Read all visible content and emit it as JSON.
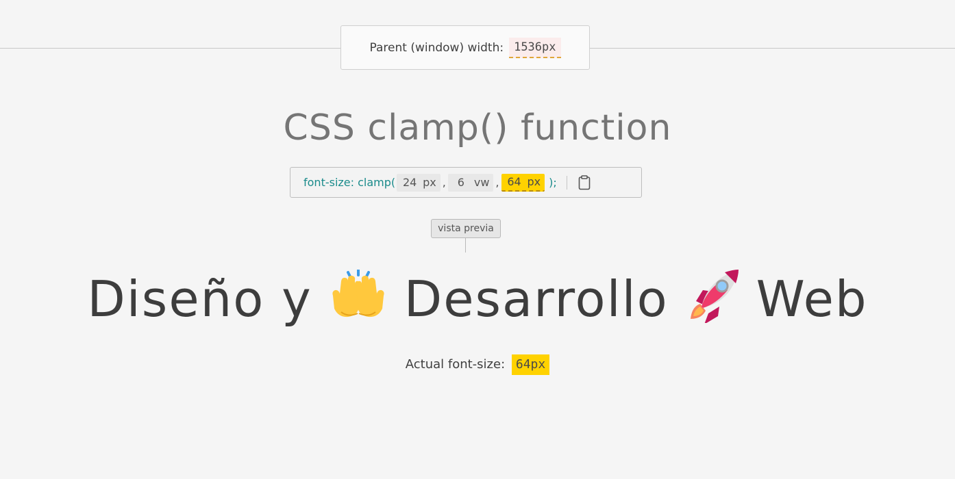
{
  "width_indicator": {
    "label": "Parent (window) width:",
    "value": "1536px"
  },
  "title": "CSS clamp() function",
  "code": {
    "prefix": "font-size: clamp(",
    "args": [
      {
        "num": "24",
        "unit": "px"
      },
      {
        "num": "6",
        "unit": "vw"
      },
      {
        "num": "64",
        "unit": "px"
      }
    ],
    "separator": ",",
    "suffix": ");",
    "copy_icon": "clipboard-icon"
  },
  "preview": {
    "tag": "vista previa",
    "words": [
      "Diseño y",
      "Desarrollo",
      "Web"
    ],
    "emojis": [
      "raising-hands-icon",
      "rocket-icon"
    ]
  },
  "actual": {
    "label": "Actual font-size:",
    "value": "64px"
  },
  "colors": {
    "background": "#f5f5f5",
    "accent_yellow": "#ffd200",
    "code_teal": "#1a8b8b",
    "width_highlight": "#fbecec",
    "dashed_orange": "#e0a63a"
  }
}
